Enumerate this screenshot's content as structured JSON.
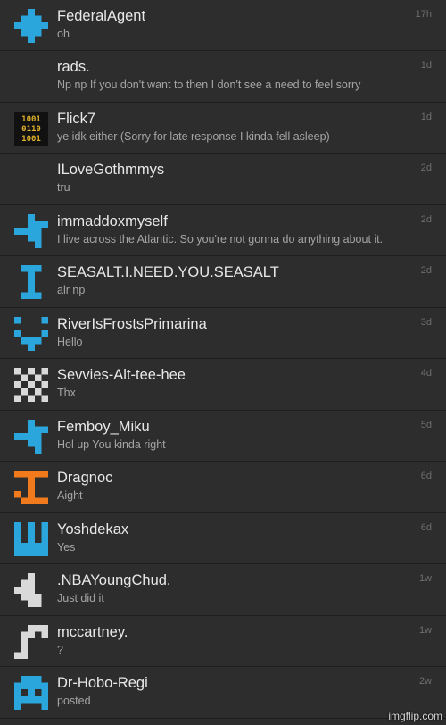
{
  "conversations": [
    {
      "name": "FederalAgent",
      "message": "oh",
      "time": "17h",
      "avatar": "blue-cross-avatar-icon"
    },
    {
      "name": "rads.",
      "message": "Np np If you don't want to then I don't see a need to feel sorry",
      "time": "1d",
      "avatar": "none"
    },
    {
      "name": "Flick7",
      "message": "ye idk either (Sorry for late response I kinda fell asleep)",
      "time": "1d",
      "avatar": "binary-avatar-icon"
    },
    {
      "name": "ILoveGothmmys",
      "message": "tru",
      "time": "2d",
      "avatar": "none"
    },
    {
      "name": "immaddoxmyself",
      "message": "I live across the Atlantic. So you're not gonna do anything about it.",
      "time": "2d",
      "avatar": "blue-pixel-avatar-icon"
    },
    {
      "name": "SEASALT.I.NEED.YOU.SEASALT",
      "message": "alr np",
      "time": "2d",
      "avatar": "blue-i-avatar-icon"
    },
    {
      "name": "RiverIsFrostsPrimarina",
      "message": "Hello",
      "time": "3d",
      "avatar": "blue-smile-avatar-icon"
    },
    {
      "name": "Sevvies-Alt-tee-hee",
      "message": "Thx",
      "time": "4d",
      "avatar": "checker-avatar-icon"
    },
    {
      "name": "Femboy_Miku",
      "message": "Hol up You kinda right",
      "time": "5d",
      "avatar": "blue-pixel-avatar-icon"
    },
    {
      "name": "Dragnoc",
      "message": "Aight",
      "time": "6d",
      "avatar": "orange-i-avatar-icon"
    },
    {
      "name": "Yoshdekax",
      "message": "Yes",
      "time": "6d",
      "avatar": "blue-y-avatar-icon"
    },
    {
      "name": ".NBAYoungChud.",
      "message": "Just did it",
      "time": "1w",
      "avatar": "gray-pixel-avatar-icon"
    },
    {
      "name": "mccartney.",
      "message": "?",
      "time": "1w",
      "avatar": "gray-hook-avatar-icon"
    },
    {
      "name": "Dr-Hobo-Regi",
      "message": "posted",
      "time": "2w",
      "avatar": "blue-invader-avatar-icon"
    }
  ],
  "watermark": "imgflip.com",
  "colors": {
    "background": "#2d2d2d",
    "divider": "#1e1e1e",
    "name": "#e8e8e8",
    "message": "#a5a5a5",
    "time": "#6e6e6e",
    "blue": "#2aa6dc",
    "orange": "#f07a1c",
    "gray": "#d9d9d9"
  }
}
